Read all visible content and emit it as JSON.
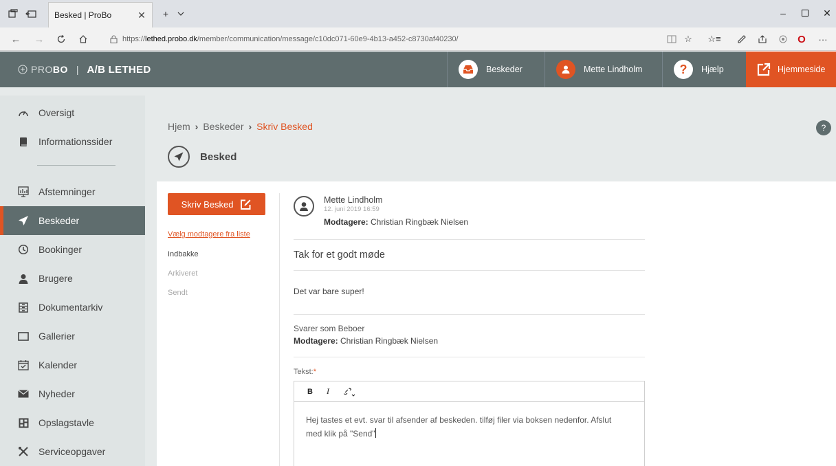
{
  "browser": {
    "tab_title": "Besked | ProBo",
    "url_prefix": "https://",
    "url_host": "lethed.probo.dk",
    "url_path": "/member/communication/message/c10dc071-60e9-4b13-a452-c8730af40230/"
  },
  "header": {
    "logo_light": "PRO",
    "logo_bold": "BO",
    "separator": "|",
    "org_name": "A/B LETHED",
    "messages_label": "Beskeder",
    "user_name": "Mette Lindholm",
    "help_label": "Hjælp",
    "homepage_label": "Hjemmeside"
  },
  "sidebar": {
    "items": [
      {
        "label": "Oversigt",
        "icon": "dashboard-gauge-icon"
      },
      {
        "label": "Informationssider",
        "icon": "book-icon"
      },
      {
        "label": "Afstemninger",
        "icon": "poll-chart-icon"
      },
      {
        "label": "Beskeder",
        "icon": "paper-plane-icon",
        "active": true
      },
      {
        "label": "Bookinger",
        "icon": "clock-icon"
      },
      {
        "label": "Brugere",
        "icon": "user-icon"
      },
      {
        "label": "Dokumentarkiv",
        "icon": "archive-icon"
      },
      {
        "label": "Gallerier",
        "icon": "gallery-frame-icon"
      },
      {
        "label": "Kalender",
        "icon": "calendar-check-icon"
      },
      {
        "label": "Nyheder",
        "icon": "envelope-icon"
      },
      {
        "label": "Opslagstavle",
        "icon": "board-icon"
      },
      {
        "label": "Serviceopgaver",
        "icon": "tools-icon"
      }
    ]
  },
  "breadcrumb": {
    "home": "Hjem",
    "messages": "Beskeder",
    "current": "Skriv Besked",
    "separator": "›"
  },
  "page": {
    "title": "Besked",
    "help": "?"
  },
  "folders": {
    "compose_label": "Skriv Besked",
    "choose_recipients": "Vælg modtagere fra liste",
    "inbox": "Indbakke",
    "archived": "Arkiveret",
    "sent": "Sendt"
  },
  "message": {
    "sender": "Mette Lindholm",
    "date": "12. juni 2019 16:59",
    "recipients_label": "Modtagere:",
    "recipients": "Christian Ringbæk Nielsen",
    "subject": "Tak for et godt møde",
    "body": "Det var bare super!"
  },
  "reply": {
    "reply_as": "Svarer som Beboer",
    "recipients_label": "Modtagere:",
    "recipients": "Christian Ringbæk Nielsen",
    "text_label": "Tekst:",
    "required_mark": "*",
    "toolbar": {
      "bold": "B",
      "italic": "I"
    },
    "editor_text": "Hej tastes et evt. svar til afsender af beskeden. tilføj filer via boksen nedenfor. Afslut med klik på \"Send\""
  },
  "colors": {
    "accent": "#e05423",
    "header_bg": "#5f6d6e",
    "sidebar_bg": "#dfe4e4"
  }
}
